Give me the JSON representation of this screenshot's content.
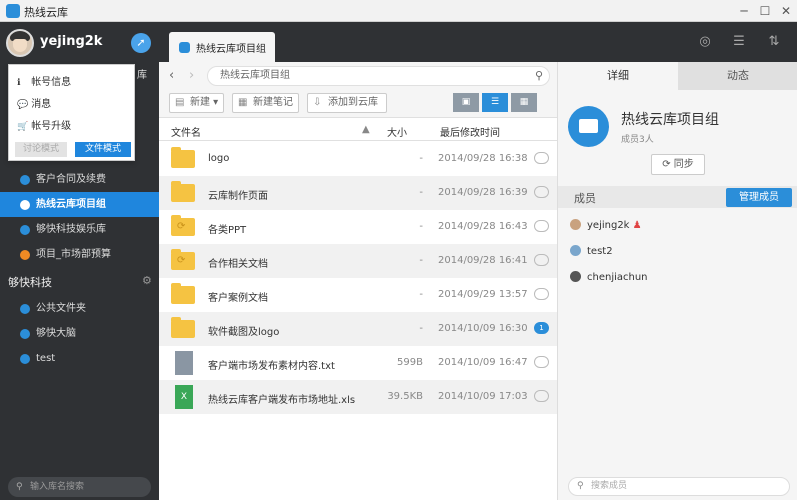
{
  "window": {
    "title": "热线云库",
    "controls": [
      "─",
      "☐",
      "✕"
    ]
  },
  "user": {
    "name": "yejing2k"
  },
  "popup_menu": {
    "items": [
      {
        "icon": "info-icon",
        "glyph": "ℹ",
        "label": "帐号信息"
      },
      {
        "icon": "message-icon",
        "glyph": "💬",
        "label": "消息"
      },
      {
        "icon": "cart-icon",
        "glyph": "🛒",
        "label": "帐号升级"
      }
    ],
    "mode_discussion": "讨论模式",
    "mode_file": "文件模式",
    "behind_label": "库"
  },
  "sidebar": {
    "items": [
      {
        "label": "客户合同及续费"
      },
      {
        "label": "热线云库项目组"
      },
      {
        "label": "够快科技娱乐库"
      },
      {
        "label": "项目_市场部预算"
      }
    ],
    "group_title": "够快科技",
    "group_items": [
      {
        "label": "公共文件夹"
      },
      {
        "label": "够快大脑"
      },
      {
        "label": "test"
      }
    ],
    "search_placeholder": "输入库名搜索"
  },
  "tab": {
    "label": "热线云库项目组"
  },
  "path": {
    "text": "热线云库项目组"
  },
  "toolbar": {
    "new_label": "新建",
    "new_note_label": "新建笔记",
    "add_to_lib_label": "添加到云库"
  },
  "table": {
    "headers": {
      "name": "文件名",
      "size": "大小",
      "modified": "最后修改时间"
    },
    "rows": [
      {
        "type": "folder",
        "name": "logo",
        "size": "-",
        "date": "2014/09/28 16:38",
        "comments": ""
      },
      {
        "type": "folder",
        "name": "云库制作页面",
        "size": "-",
        "date": "2014/09/28 16:39",
        "comments": ""
      },
      {
        "type": "sync-folder",
        "name": "各类PPT",
        "size": "-",
        "date": "2014/09/28 16:43",
        "comments": ""
      },
      {
        "type": "sync-folder",
        "name": "合作相关文档",
        "size": "-",
        "date": "2014/09/28 16:41",
        "comments": ""
      },
      {
        "type": "folder",
        "name": "客户案例文档",
        "size": "-",
        "date": "2014/09/29 13:57",
        "comments": ""
      },
      {
        "type": "folder",
        "name": "软件截图及logo",
        "size": "-",
        "date": "2014/10/09 16:30",
        "comments": "1"
      },
      {
        "type": "txt",
        "name": "客户端市场发布素材内容.txt",
        "size": "599B",
        "date": "2014/10/09 16:47",
        "comments": ""
      },
      {
        "type": "xls",
        "name": "热线云库客户端发布市场地址.xls",
        "size": "39.5KB",
        "date": "2014/10/09 17:03",
        "comments": ""
      }
    ]
  },
  "detail": {
    "tab_detail": "详细",
    "tab_activity": "动态",
    "project_name": "热线云库项目组",
    "member_count": "成员3人",
    "sync_label": "同步",
    "members_title": "成员",
    "manage_label": "管理成员",
    "members": [
      {
        "name": "yejing2k",
        "admin": true
      },
      {
        "name": "test2",
        "admin": false
      },
      {
        "name": "chenjiachun",
        "admin": false
      }
    ],
    "member_search_placeholder": "搜索成员"
  },
  "colors": {
    "accent": "#2b8ed9",
    "sidebar_bg": "#2f3134",
    "folder": "#f5c342"
  }
}
